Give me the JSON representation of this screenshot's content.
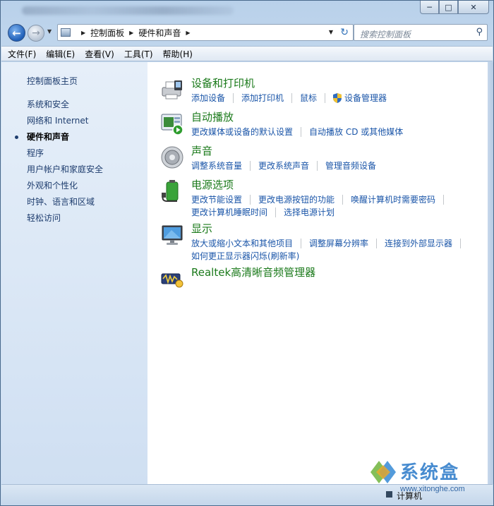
{
  "window": {
    "caption_buttons": [
      "minimize-icon",
      "maximize-icon",
      "close-icon"
    ]
  },
  "nav": {
    "breadcrumb": [
      "控制面板",
      "硬件和声音"
    ],
    "search_placeholder": "搜索控制面板"
  },
  "menu": [
    "文件(F)",
    "编辑(E)",
    "查看(V)",
    "工具(T)",
    "帮助(H)"
  ],
  "sidebar": {
    "home": "控制面板主页",
    "items": [
      {
        "label": "系统和安全",
        "current": false
      },
      {
        "label": "网络和 Internet",
        "current": false
      },
      {
        "label": "硬件和声音",
        "current": true
      },
      {
        "label": "程序",
        "current": false
      },
      {
        "label": "用户帐户和家庭安全",
        "current": false
      },
      {
        "label": "外观和个性化",
        "current": false
      },
      {
        "label": "时钟、语言和区域",
        "current": false
      },
      {
        "label": "轻松访问",
        "current": false
      }
    ]
  },
  "categories": [
    {
      "title": "设备和打印机",
      "icon": "printer-icon",
      "links": [
        "添加设备",
        "添加打印机",
        "鼠标",
        "设备管理器"
      ]
    },
    {
      "title": "自动播放",
      "icon": "autoplay-icon",
      "links": [
        "更改媒体或设备的默认设置",
        "自动播放 CD 或其他媒体"
      ]
    },
    {
      "title": "声音",
      "icon": "speaker-icon",
      "links": [
        "调整系统音量",
        "更改系统声音",
        "管理音频设备"
      ]
    },
    {
      "title": "电源选项",
      "icon": "battery-icon",
      "links": [
        "更改节能设置",
        "更改电源按钮的功能",
        "唤醒计算机时需要密码",
        "更改计算机睡眠时间",
        "选择电源计划"
      ]
    },
    {
      "title": "显示",
      "icon": "monitor-icon",
      "links": [
        "放大或缩小文本和其他项目",
        "调整屏幕分辨率",
        "连接到外部显示器",
        "如何更正显示器闪烁(刷新率)"
      ]
    },
    {
      "title": "Realtek高清晰音频管理器",
      "icon": "realtek-audio-icon",
      "links": []
    }
  ],
  "status": {
    "label": "计算机"
  },
  "watermark": {
    "text": "系统盒",
    "url": "www.xitonghe.com"
  },
  "colors": {
    "category_title": "#1b7a1b",
    "link": "#1a55a8",
    "sidebar_link": "#1e3d6e"
  }
}
